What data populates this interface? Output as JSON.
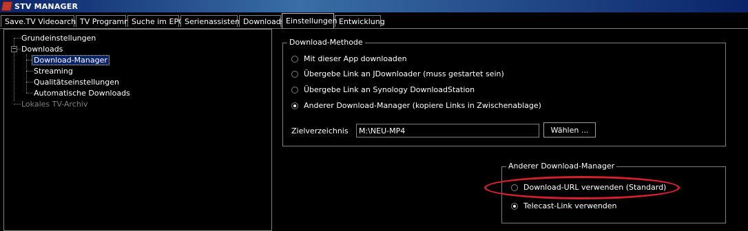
{
  "window": {
    "title": "STV MANAGER"
  },
  "tabs": [
    {
      "label": "Save.TV Videoarchiv"
    },
    {
      "label": "TV Programm"
    },
    {
      "label": "Suche im EPG"
    },
    {
      "label": "Serienassistent"
    },
    {
      "label": "Downloads"
    },
    {
      "label": "Einstellungen",
      "active": true
    },
    {
      "label": "Entwicklung"
    }
  ],
  "tree": {
    "items": [
      {
        "label": "Grundeinstellungen"
      },
      {
        "label": "Downloads",
        "expanded": true
      },
      {
        "label": "Download-Manager",
        "selected": true
      },
      {
        "label": "Streaming"
      },
      {
        "label": "Qualitätseinstellungen"
      },
      {
        "label": "Automatische Downloads"
      },
      {
        "label": "Lokales TV-Archiv",
        "disabled": true
      }
    ],
    "expander_symbol": "−"
  },
  "download_method": {
    "title": "Download-Methode",
    "options": [
      {
        "label": "Mit dieser App downloaden",
        "checked": false
      },
      {
        "label": "Übergebe Link an JDownloader (muss gestartet sein)",
        "checked": false
      },
      {
        "label": "Übergebe Link an Synology DownloadStation",
        "checked": false
      },
      {
        "label": "Anderer Download-Manager (kopiere Links in Zwischenablage)",
        "checked": true
      }
    ],
    "target_dir_label": "Zielverzeichnis",
    "target_dir_value": "M:\\NEU-MP4",
    "choose_button": "Wählen ..."
  },
  "other_manager": {
    "title": "Anderer Download-Manager",
    "options": [
      {
        "label": "Download-URL verwenden (Standard)",
        "checked": false
      },
      {
        "label": "Telecast-Link verwenden",
        "checked": true
      }
    ]
  },
  "colors": {
    "background": "#000000",
    "titlebar": "#0a246a",
    "selection": "#0a246a",
    "annotation": "#d8202a",
    "border": "#808080"
  }
}
